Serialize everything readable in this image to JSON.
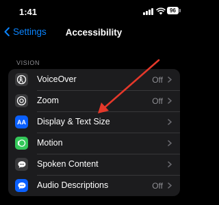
{
  "status_bar": {
    "time": "1:41",
    "battery": "96"
  },
  "nav": {
    "back_label": "Settings",
    "title": "Accessibility"
  },
  "section": {
    "header": "VISION"
  },
  "rows": [
    {
      "label": "VoiceOver",
      "value": "Off",
      "icon": "voiceover-icon",
      "icon_bg": "#3a3a3c"
    },
    {
      "label": "Zoom",
      "value": "Off",
      "icon": "zoom-icon",
      "icon_bg": "#3a3a3c"
    },
    {
      "label": "Display & Text Size",
      "value": "",
      "icon": "text-size-icon",
      "icon_text": "AA",
      "icon_bg": "#0a60ff"
    },
    {
      "label": "Motion",
      "value": "",
      "icon": "motion-icon",
      "icon_bg": "#34c759"
    },
    {
      "label": "Spoken Content",
      "value": "",
      "icon": "speech-bubble-icon",
      "icon_bg": "#3a3a3c"
    },
    {
      "label": "Audio Descriptions",
      "value": "Off",
      "icon": "audio-description-icon",
      "icon_bg": "#0a60ff"
    }
  ],
  "colors": {
    "accent": "#0a84ff",
    "arrow": "#e5382a",
    "cell_bg": "#1c1c1e"
  }
}
